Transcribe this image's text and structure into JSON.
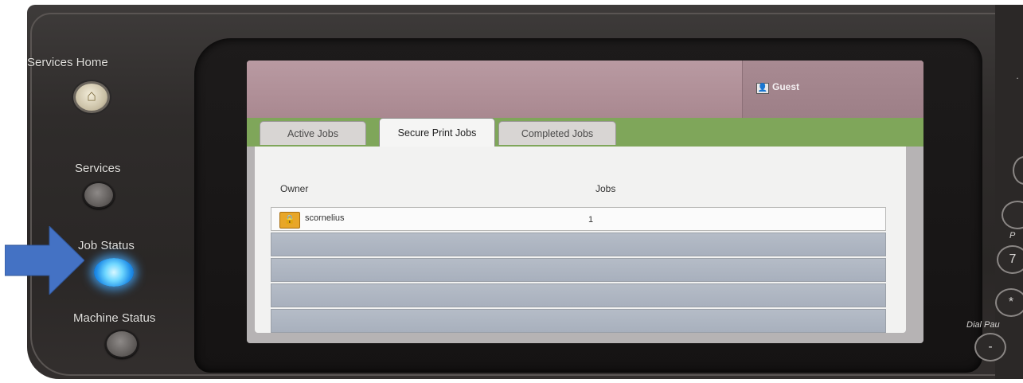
{
  "hardware_buttons": {
    "services_home_label": "Services Home",
    "services_label": "Services",
    "job_status_label": "Job Status",
    "machine_status_label": "Machine Status"
  },
  "screen": {
    "user_name": "Guest",
    "tabs": [
      {
        "label": "Active Jobs",
        "selected": false
      },
      {
        "label": "Secure Print Jobs",
        "selected": true
      },
      {
        "label": "Completed Jobs",
        "selected": false
      }
    ],
    "columns": {
      "owner": "Owner",
      "jobs": "Jobs"
    },
    "rows": [
      {
        "owner": "scornelius",
        "jobs": "1"
      }
    ]
  },
  "keypad": {
    "key_7": "7",
    "key_star": "*",
    "key_dash": "-",
    "label_p": "P",
    "label_dial_pause": "Dial Pau"
  },
  "colors": {
    "tab_band": "#7fa65a",
    "job_status_glow": "#1f8de8",
    "arrow": "#4472c4"
  }
}
